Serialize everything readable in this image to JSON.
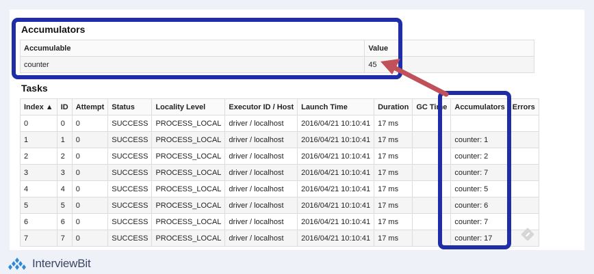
{
  "accumulators_section": {
    "title": "Accumulators",
    "columns": [
      "Accumulable",
      "Value"
    ],
    "rows": [
      [
        "counter",
        "45"
      ]
    ]
  },
  "tasks_section": {
    "title": "Tasks",
    "columns": [
      "Index ▲",
      "ID",
      "Attempt",
      "Status",
      "Locality Level",
      "Executor ID / Host",
      "Launch Time",
      "Duration",
      "GC Time",
      "Accumulators",
      "Errors"
    ],
    "rows": [
      [
        "0",
        "0",
        "0",
        "SUCCESS",
        "PROCESS_LOCAL",
        "driver / localhost",
        "2016/04/21 10:10:41",
        "17 ms",
        "",
        ""
      ],
      [
        "1",
        "1",
        "0",
        "SUCCESS",
        "PROCESS_LOCAL",
        "driver / localhost",
        "2016/04/21 10:10:41",
        "17 ms",
        "",
        "counter: 1"
      ],
      [
        "2",
        "2",
        "0",
        "SUCCESS",
        "PROCESS_LOCAL",
        "driver / localhost",
        "2016/04/21 10:10:41",
        "17 ms",
        "",
        "counter: 2"
      ],
      [
        "3",
        "3",
        "0",
        "SUCCESS",
        "PROCESS_LOCAL",
        "driver / localhost",
        "2016/04/21 10:10:41",
        "17 ms",
        "",
        "counter: 7"
      ],
      [
        "4",
        "4",
        "0",
        "SUCCESS",
        "PROCESS_LOCAL",
        "driver / localhost",
        "2016/04/21 10:10:41",
        "17 ms",
        "",
        "counter: 5"
      ],
      [
        "5",
        "5",
        "0",
        "SUCCESS",
        "PROCESS_LOCAL",
        "driver / localhost",
        "2016/04/21 10:10:41",
        "17 ms",
        "",
        "counter: 6"
      ],
      [
        "6",
        "6",
        "0",
        "SUCCESS",
        "PROCESS_LOCAL",
        "driver / localhost",
        "2016/04/21 10:10:41",
        "17 ms",
        "",
        "counter: 7"
      ],
      [
        "7",
        "7",
        "0",
        "SUCCESS",
        "PROCESS_LOCAL",
        "driver / localhost",
        "2016/04/21 10:10:41",
        "17 ms",
        "",
        "counter: 17"
      ]
    ]
  },
  "annotations": {
    "highlight_color": "#1f2da8",
    "arrow_color": "#c0505a"
  },
  "logo": {
    "text": "InterviewBit",
    "icon": "interviewbit-logo-icon"
  }
}
